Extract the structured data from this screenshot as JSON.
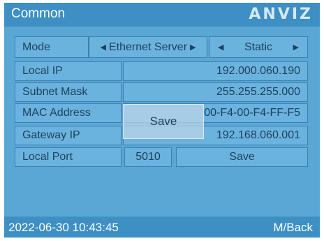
{
  "window": {
    "title": "Common",
    "logo": "ANVIZ"
  },
  "form": {
    "mode": {
      "label": "Mode",
      "value": "Ethernet Server",
      "option2": "Static"
    },
    "local_ip": {
      "label": "Local IP",
      "value": "192.000.060.190"
    },
    "subnet_mask": {
      "label": "Subnet Mask",
      "value": "255.255.255.000"
    },
    "mac_address": {
      "label": "MAC Address",
      "value": "00-F4-00-F4-FF-F5"
    },
    "gateway_ip": {
      "label": "Gateway IP",
      "value": "192.168.060.001"
    },
    "local_port": {
      "label": "Local Port",
      "value": "5010",
      "save_label": "Save"
    }
  },
  "popup": {
    "label": "Save"
  },
  "footer": {
    "datetime": "2022-06-30 10:43:45",
    "back_label": "M/Back"
  },
  "icons": {
    "left_arrow": "triangle-left-icon",
    "right_arrow": "triangle-right-icon"
  }
}
